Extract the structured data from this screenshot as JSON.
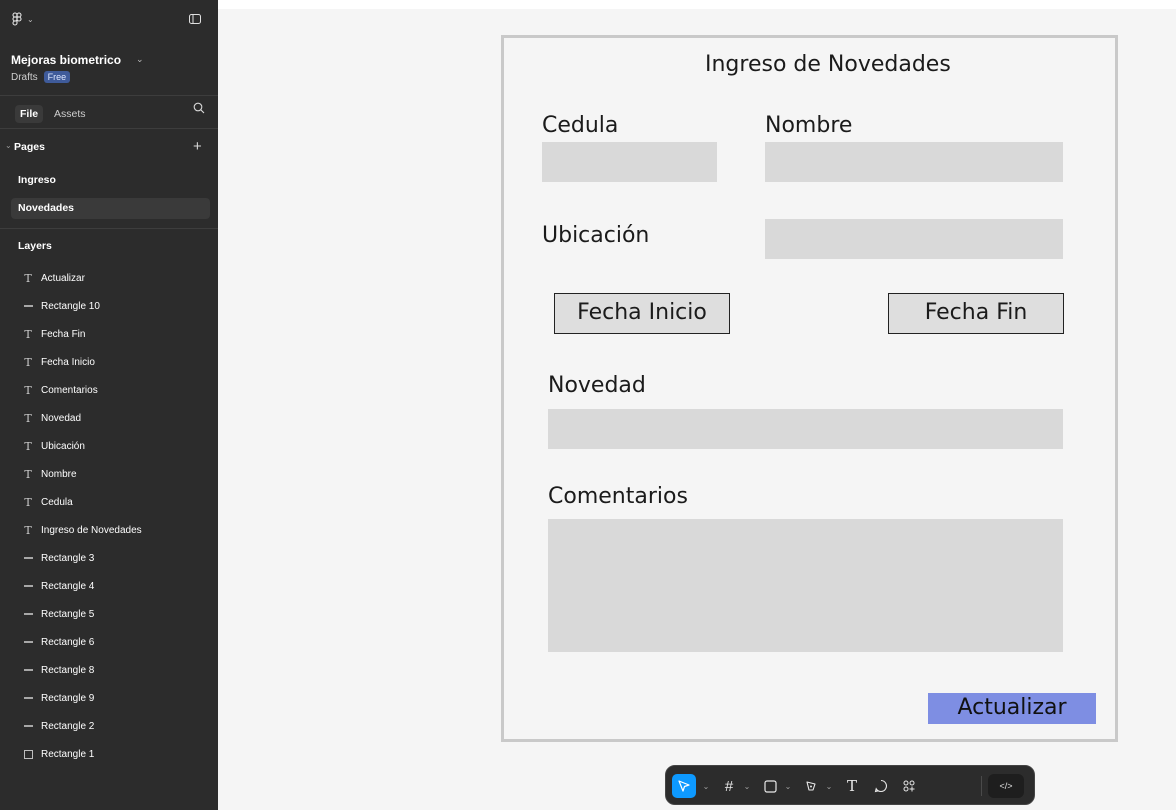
{
  "sidebar": {
    "project_title": "Mejoras biometrico",
    "drafts_label": "Drafts",
    "plan_badge": "Free",
    "tabs": {
      "file": "File",
      "assets": "Assets"
    },
    "pages_title": "Pages",
    "pages": [
      "Ingreso",
      "Novedades"
    ],
    "selected_page": "Novedades",
    "layers_title": "Layers",
    "layers": [
      {
        "label": "Actualizar",
        "icon": "text-icon"
      },
      {
        "label": "Rectangle 10",
        "icon": "line-icon"
      },
      {
        "label": "Fecha Fin",
        "icon": "text-icon"
      },
      {
        "label": "Fecha Inicio",
        "icon": "text-icon"
      },
      {
        "label": "Comentarios",
        "icon": "text-icon"
      },
      {
        "label": "Novedad",
        "icon": "text-icon"
      },
      {
        "label": "Ubicación",
        "icon": "text-icon"
      },
      {
        "label": "Nombre",
        "icon": "text-icon"
      },
      {
        "label": "Cedula",
        "icon": "text-icon"
      },
      {
        "label": "Ingreso de Novedades",
        "icon": "text-icon"
      },
      {
        "label": "Rectangle 3",
        "icon": "line-icon"
      },
      {
        "label": "Rectangle 4",
        "icon": "line-icon"
      },
      {
        "label": "Rectangle 5",
        "icon": "line-icon"
      },
      {
        "label": "Rectangle 6",
        "icon": "line-icon"
      },
      {
        "label": "Rectangle 8",
        "icon": "line-icon"
      },
      {
        "label": "Rectangle 9",
        "icon": "line-icon"
      },
      {
        "label": "Rectangle 2",
        "icon": "line-icon"
      },
      {
        "label": "Rectangle 1",
        "icon": "rectangle-icon"
      }
    ]
  },
  "frame": {
    "title": "Ingreso de Novedades",
    "cedula_label": "Cedula",
    "nombre_label": "Nombre",
    "ubicacion_label": "Ubicación",
    "fecha_inicio": "Fecha Inicio",
    "fecha_fin": "Fecha Fin",
    "novedad_label": "Novedad",
    "comentarios_label": "Comentarios",
    "actualizar": "Actualizar"
  },
  "toolbar": {
    "tools": [
      "move-tool",
      "frame-tool",
      "rectangle-tool",
      "pen-tool",
      "text-tool",
      "comment-tool",
      "actions-tool"
    ],
    "active_tool": "move-tool",
    "dev_mode_label": "</>"
  },
  "colors": {
    "sidebar_bg": "#2c2c2c",
    "canvas_bg": "#f5f5f5",
    "field_bg": "#d9d9d9",
    "accent_blue": "#0d99ff",
    "update_button": "#7e8ee3",
    "free_badge": "#3f5b9a"
  }
}
